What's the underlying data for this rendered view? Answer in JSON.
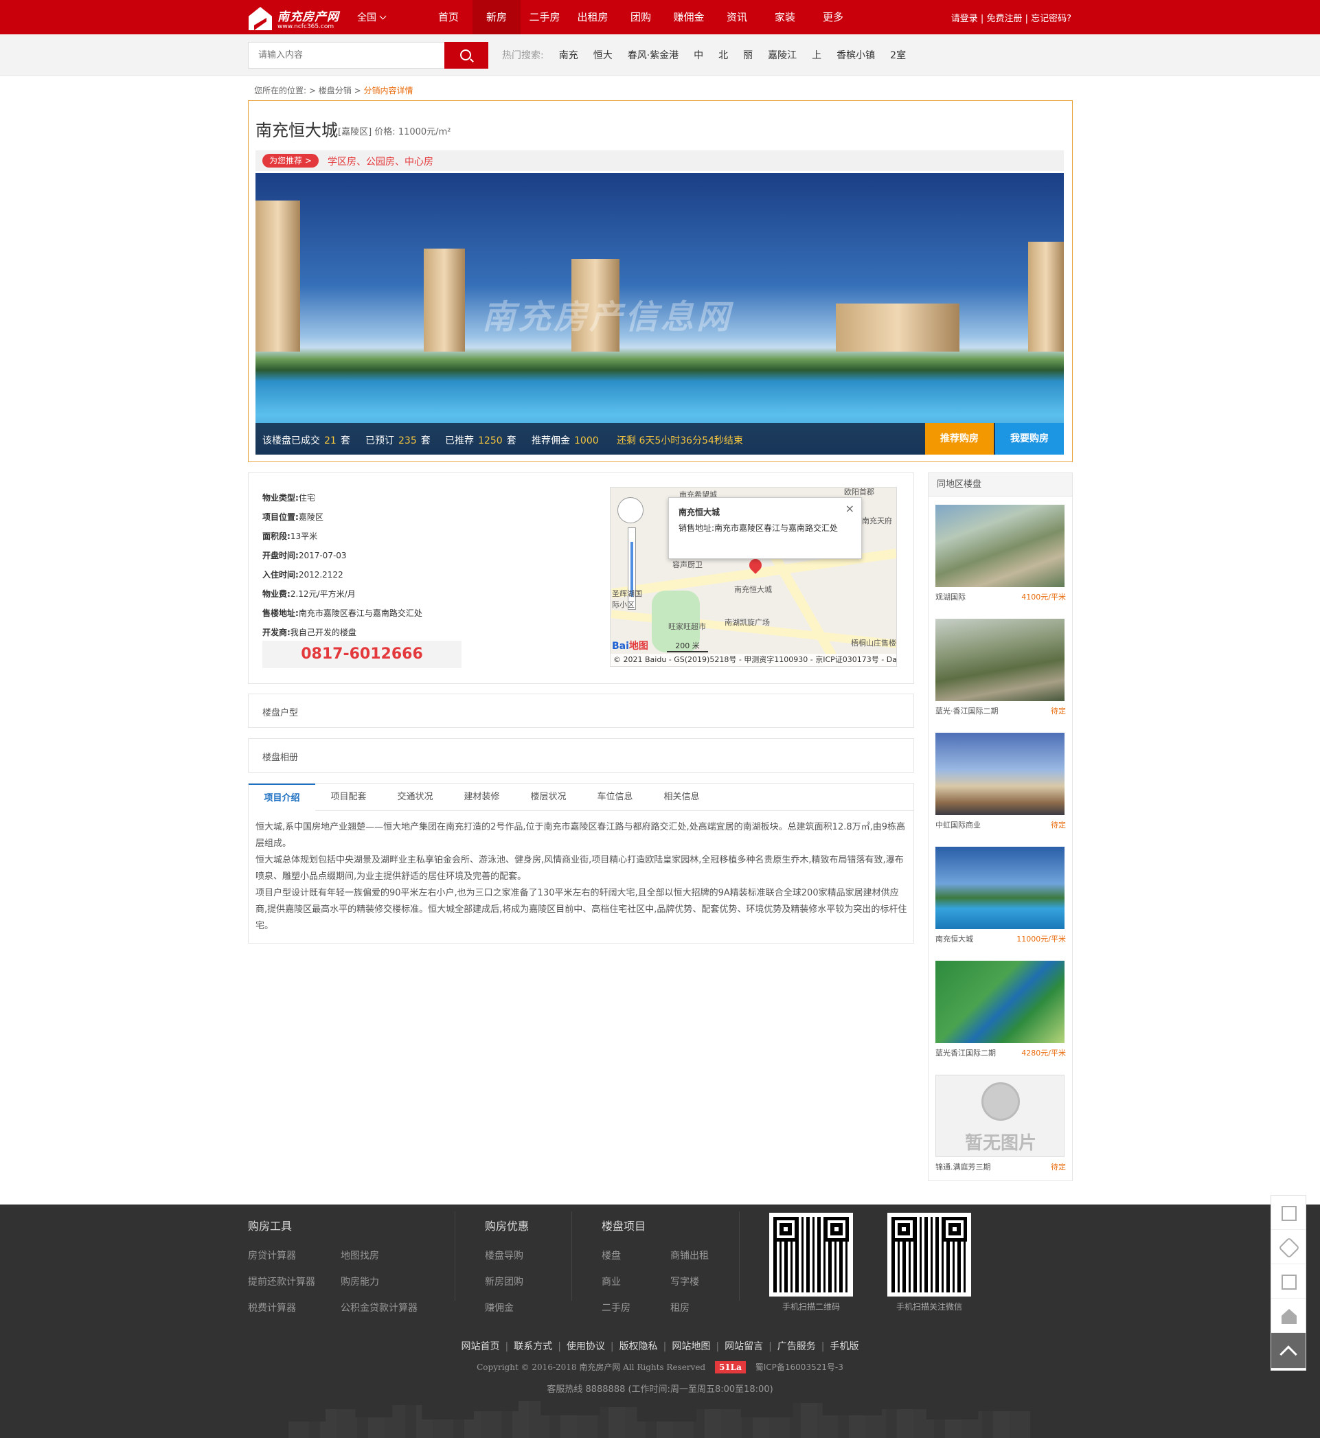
{
  "header": {
    "logo_text": "南充房产网",
    "logo_url": "www.ncfc365.com",
    "city": "全国",
    "nav": [
      "首页",
      "新房",
      "二手房",
      "出租房",
      "团购",
      "赚佣金",
      "资讯",
      "家装",
      "更多"
    ],
    "active_nav": "新房",
    "user_links": "请登录 | 免费注册 | 忘记密码?"
  },
  "search": {
    "placeholder": "请输入内容",
    "hot_label": "热门搜索:",
    "hot_keywords": [
      "南充",
      "恒大",
      "春风·紫金港",
      "中",
      "北",
      "丽",
      "嘉陵江",
      "上",
      "香槟小镇",
      "2室"
    ]
  },
  "breadcrumb": {
    "prefix": "您所在的位置:",
    "items": [
      "楼盘分销",
      "分销内容详情"
    ],
    "sep": ">"
  },
  "project": {
    "title": "南充恒大城",
    "district": "[嘉陵区]",
    "price_label": "价格:",
    "price": "11000元/m²",
    "recommend_badge": "为您推荐 >",
    "recommend_text": "学区房、公园房、中心房",
    "hero_watermark": "南充房产信息网",
    "stats": {
      "sold_label": "该楼盘已成交",
      "sold": "21",
      "reserved_label": "已预订",
      "reserved": "235",
      "recommended_label": "已推荐",
      "recommended": "1250",
      "unit": "套",
      "commission_label": "推荐佣金",
      "commission": "1000",
      "countdown": "还剩 6天5小时36分54秒结束"
    },
    "btn_recommend": "推荐购房",
    "btn_buy": "我要购房"
  },
  "info": {
    "rows": [
      {
        "label": "物业类型:",
        "value": "住宅"
      },
      {
        "label": "项目位置:",
        "value": "嘉陵区"
      },
      {
        "label": "面积段:",
        "value": "13平米"
      },
      {
        "label": "开盘时间:",
        "value": "2017-07-03"
      },
      {
        "label": "入住时间:",
        "value": "2012.2122"
      },
      {
        "label": "物业费:",
        "value": "2.12元/平方米/月"
      },
      {
        "label": "售楼地址:",
        "value": "南充市嘉陵区春江与嘉南路交汇处"
      },
      {
        "label": "开发商:",
        "value": "我自己开发的楼盘"
      }
    ],
    "phone": "0817-6012666"
  },
  "map": {
    "popup_title": "南充恒大城",
    "popup_addr": "销售地址:南充市嘉陵区春江与嘉南路交汇处",
    "labels": [
      "南充希望城",
      "欧阳首郡",
      "南充天府",
      "南充恒大城",
      "圣辉湖国际小区",
      "旺家旺超市",
      "南湖凯旋广场",
      "梧桐山庄售楼",
      "容声厨卫"
    ],
    "scale": "200 米",
    "copyright": "© 2021 Baidu - GS(2019)5218号 - 甲测资字1100930 - 京ICP证030173号 - Dat",
    "logo_a": "Bai",
    "logo_b": "地图"
  },
  "sections": {
    "floorplans": "楼盘户型",
    "album": "楼盘相册"
  },
  "tabs": {
    "items": [
      "项目介绍",
      "项目配套",
      "交通状况",
      "建材装修",
      "楼层状况",
      "车位信息",
      "相关信息"
    ],
    "active": "项目介绍",
    "content": [
      "恒大城,系中国房地产业翘楚——恒大地产集团在南充打造的2号作品,位于南充市嘉陵区春江路与都府路交汇处,处高端宜居的南湖板块。总建筑面积12.8万㎡,由9栋高层组成。",
      "恒大城总体规划包括中央湖景及湖畔业主私享铂金会所、游泳池、健身房,风情商业街,项目精心打造欧陆皇家园林,全冠移植多种名贵原生乔木,精致布局错落有致,瀑布喷泉、雕塑小品点缀期间,为业主提供舒适的居住环境及完善的配套。",
      "项目户型设计既有年轻一族偏爱的90平米左右小户,也为三口之家准备了130平米左右的轩阔大宅,且全部以恒大招牌的9A精装标准联合全球200家精品家居建材供应商,提供嘉陵区最高水平的精装修交楼标准。恒大城全部建成后,将成为嘉陵区目前中、高档住宅社区中,品牌优势、配套优势、环境优势及精装修水平较为突出的标杆住宅。"
    ]
  },
  "sidebar": {
    "title": "同地区楼盘",
    "items": [
      {
        "name": "观湖国际",
        "price": "4100元/平米",
        "kind": "aerial"
      },
      {
        "name": "蓝光·香江国际二期",
        "price": "待定",
        "kind": "aerial2"
      },
      {
        "name": "中虹国际商业",
        "price": "待定",
        "kind": "city"
      },
      {
        "name": "南充恒大城",
        "price": "11000元/平米",
        "kind": "lake"
      },
      {
        "name": "蓝光香江国际二期",
        "price": "4280元/平米",
        "kind": "plan"
      },
      {
        "name": "锦通.满庭芳三期",
        "price": "待定",
        "kind": "none",
        "noimg": "暂无图片"
      }
    ]
  },
  "footer": {
    "col1_title": "购房工具",
    "col1_links": [
      "房贷计算器",
      "地图找房",
      "提前还款计算器",
      "购房能力",
      "税费计算器",
      "公积金贷款计算器"
    ],
    "col2_title": "购房优惠",
    "col2_links": [
      "楼盘导购",
      "新房团购",
      "赚佣金"
    ],
    "col3_title": "楼盘项目",
    "col3_links": [
      "楼盘",
      "商铺出租",
      "商业",
      "写字楼",
      "二手房",
      "租房"
    ],
    "qr1_caption": "手机扫描二维码",
    "qr2_caption": "手机扫描关注微信",
    "bottom_links": [
      "网站首页",
      "联系方式",
      "使用协议",
      "版权隐私",
      "网站地图",
      "网站留言",
      "广告服务",
      "手机版"
    ],
    "copyright": "Copyright © 2016-2018 南充房产网 All Rights Reserved",
    "badge": "51La",
    "icp": "蜀ICP备16003521号-3",
    "hotline": "客服热线 8888888 (工作时间:周一至周五8:00至18:00)"
  }
}
